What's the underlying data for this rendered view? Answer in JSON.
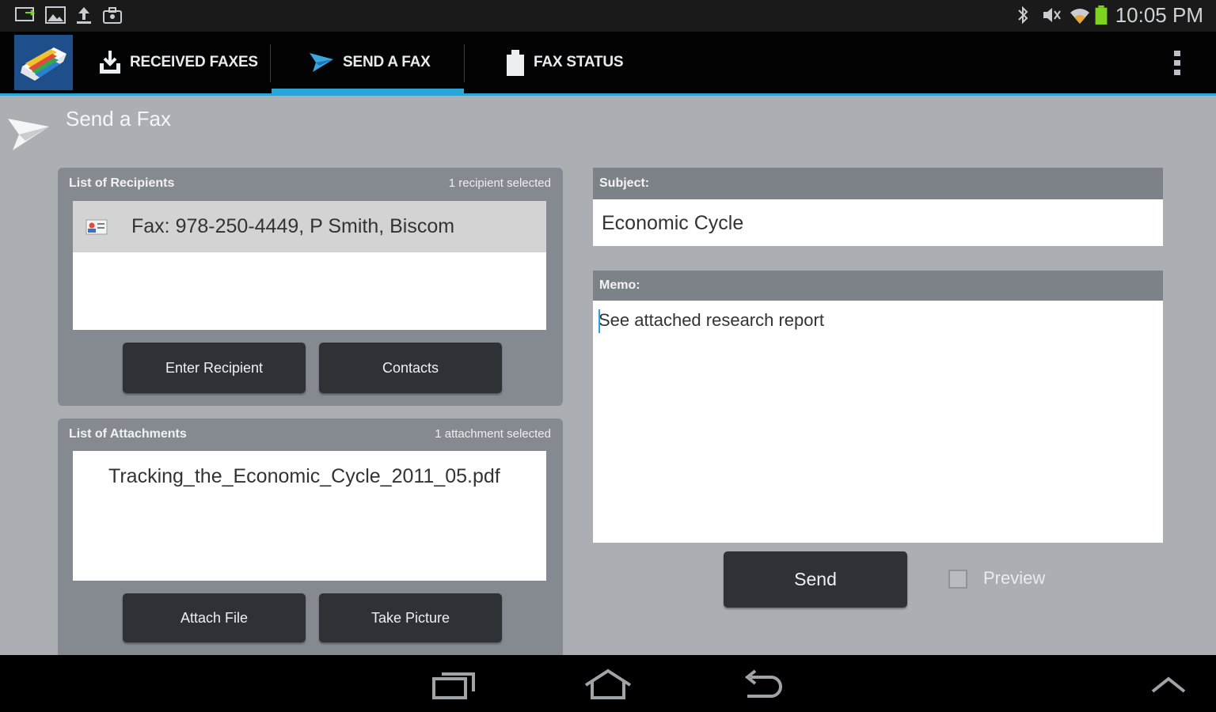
{
  "status_bar": {
    "time": "10:05 PM",
    "left_icons": [
      "screen-mirror-icon",
      "gallery-icon",
      "upload-icon",
      "briefcase-icon"
    ],
    "right_icons": [
      "bluetooth-icon",
      "mute-icon",
      "wifi-icon",
      "battery-icon"
    ],
    "battery_color": "#7ed321"
  },
  "action_bar": {
    "tabs": [
      {
        "label": "RECEIVED FAXES",
        "icon": "download-tray-icon"
      },
      {
        "label": "SEND A FAX",
        "icon": "paper-plane-icon",
        "selected": true
      },
      {
        "label": "FAX STATUS",
        "icon": "clipboard-icon"
      }
    ],
    "accent": "#2aa5d8"
  },
  "page": {
    "title": "Send a Fax"
  },
  "recipients": {
    "heading": "List of Recipients",
    "count": "1 recipient selected",
    "items": [
      "Fax: 978-250-4449, P Smith, Biscom"
    ],
    "enter_button": "Enter Recipient",
    "contacts_button": "Contacts"
  },
  "attachments": {
    "heading": "List of Attachments",
    "count": "1 attachment selected",
    "items": [
      "Tracking_the_Economic_Cycle_2011_05.pdf"
    ],
    "attach_button": "Attach File",
    "picture_button": "Take Picture"
  },
  "subject": {
    "label": "Subject:",
    "value": "Economic Cycle"
  },
  "memo": {
    "label": "Memo:",
    "value": "See attached research report"
  },
  "actions": {
    "send_label": "Send",
    "preview_label": "Preview"
  }
}
